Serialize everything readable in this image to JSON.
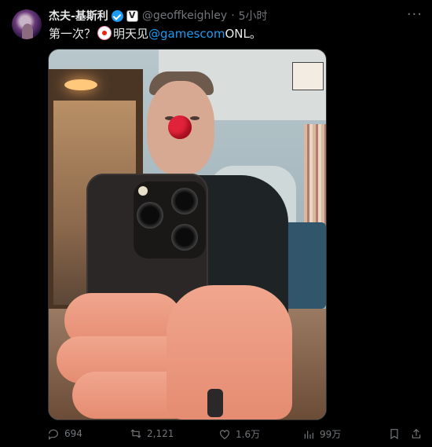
{
  "tweet": {
    "author_name": "杰夫-基斯利",
    "handle": "@geoffkeighley",
    "separator": "·",
    "time": "5小时",
    "text_prefix": "第一次？",
    "text_middle": "明天见",
    "mention": "@gamescom",
    "text_suffix": "ONL。",
    "more_label": "···"
  },
  "actions": {
    "replies": "694",
    "retweets": "2,121",
    "likes": "1.6万",
    "views": "99万"
  },
  "colors": {
    "background": "#000000",
    "text": "#e7e9ea",
    "secondary": "#71767b",
    "link": "#1d9bf0",
    "verified": "#1d9bf0"
  },
  "icons": [
    "verified-badge-icon",
    "affiliate-badge-icon",
    "more-icon",
    "clown-emoji",
    "reply-icon",
    "retweet-icon",
    "like-icon",
    "views-icon",
    "bookmark-icon",
    "share-icon"
  ]
}
